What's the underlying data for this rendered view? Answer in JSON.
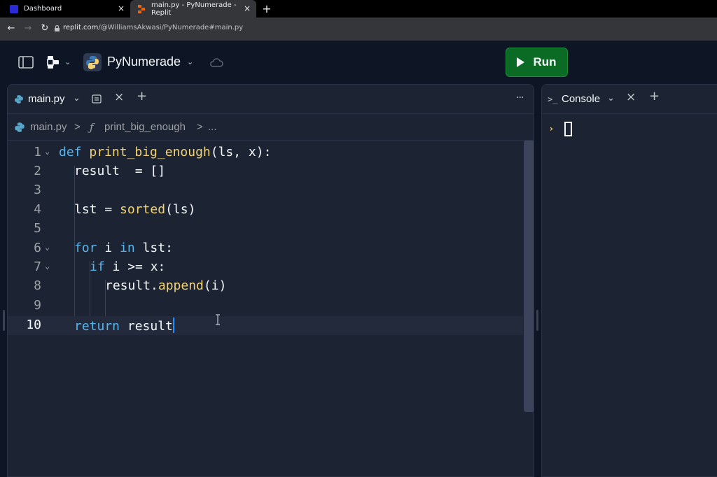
{
  "browser": {
    "tabs": [
      {
        "title": "Dashboard",
        "close": "×"
      },
      {
        "title": "main.py - PyNumerade - Replit",
        "close": "×"
      }
    ],
    "new_tab": "+",
    "url_host": "replit.com",
    "url_path": "/@WilliamsAkwasi/PyNumerade#main.py"
  },
  "header": {
    "project_name": "PyNumerade",
    "run_label": "Run"
  },
  "editor": {
    "tab_label": "main.py",
    "tab_close": "×",
    "tab_add": "+",
    "more": "···",
    "breadcrumb": {
      "file": "main.py",
      "sep1": ">",
      "symbol_icon": "ƒ",
      "symbol": "print_big_enough",
      "sep2": ">",
      "ellipsis": "..."
    },
    "lines": [
      {
        "n": "1"
      },
      {
        "n": "2"
      },
      {
        "n": "3"
      },
      {
        "n": "4"
      },
      {
        "n": "5"
      },
      {
        "n": "6"
      },
      {
        "n": "7"
      },
      {
        "n": "8"
      },
      {
        "n": "9"
      },
      {
        "n": "10"
      }
    ],
    "tokens": {
      "l1_kw": "def",
      "l1_fn": "print_big_enough",
      "l1_rest": "(ls, x):",
      "l2": "result  = []",
      "l4_a": "lst = ",
      "l4_fn": "sorted",
      "l4_b": "(ls)",
      "l6_kw1": "for",
      "l6_a": " i ",
      "l6_kw2": "in",
      "l6_b": " lst:",
      "l7_kw": "if",
      "l7_rest": " i >= x:",
      "l8_a": "result.",
      "l8_fn": "append",
      "l8_b": "(i)",
      "l10_kw": "return",
      "l10_rest": " result"
    }
  },
  "console": {
    "tab_label": "Console",
    "tab_close": "×",
    "tab_add": "+",
    "prompt": "›"
  },
  "colors": {
    "keyword": "#56b6f0",
    "function": "#f2d273",
    "run_green": "#0b6a23"
  }
}
